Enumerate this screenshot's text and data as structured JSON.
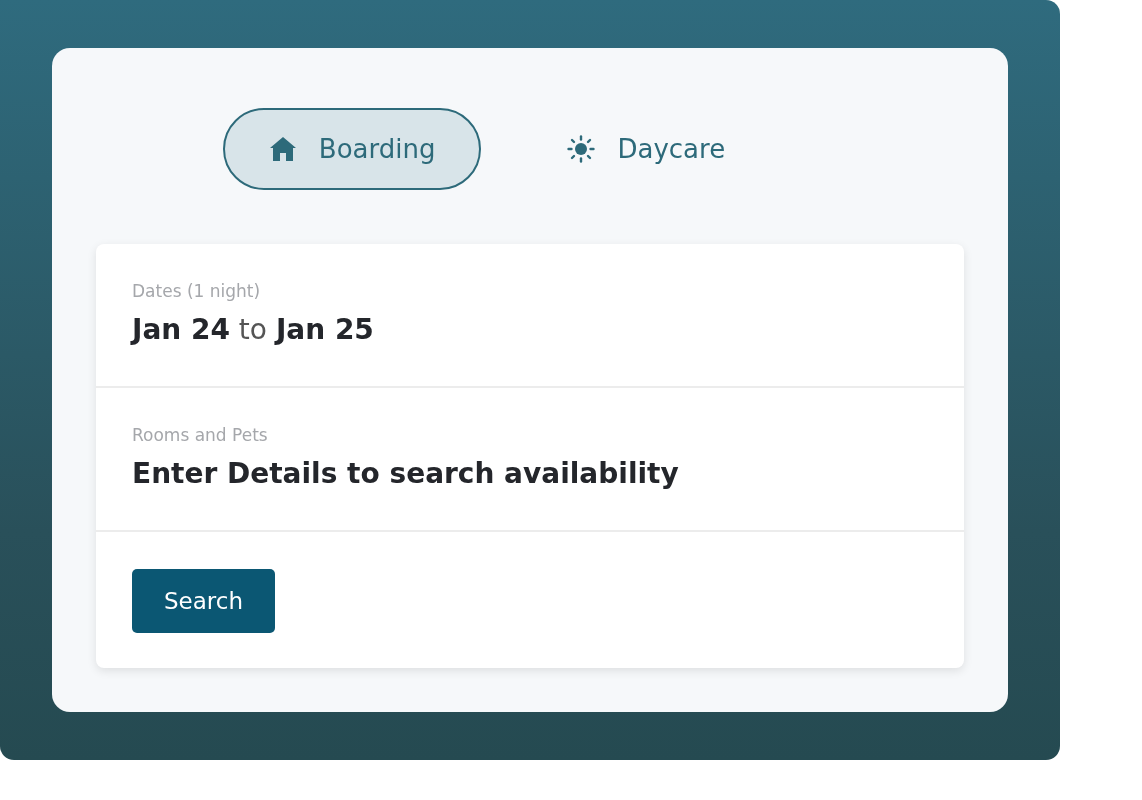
{
  "tabs": [
    {
      "label": "Boarding",
      "kind": "boarding",
      "selected": true
    },
    {
      "label": "Daycare",
      "kind": "daycare",
      "selected": false
    }
  ],
  "sections": [
    {
      "label": "Dates (1 night)",
      "value": "**Jan 24** to **Jan 25**"
    },
    {
      "label": "Rooms and Pets",
      "value": "Enter Details to search availability"
    }
  ],
  "search_button": "Search"
}
